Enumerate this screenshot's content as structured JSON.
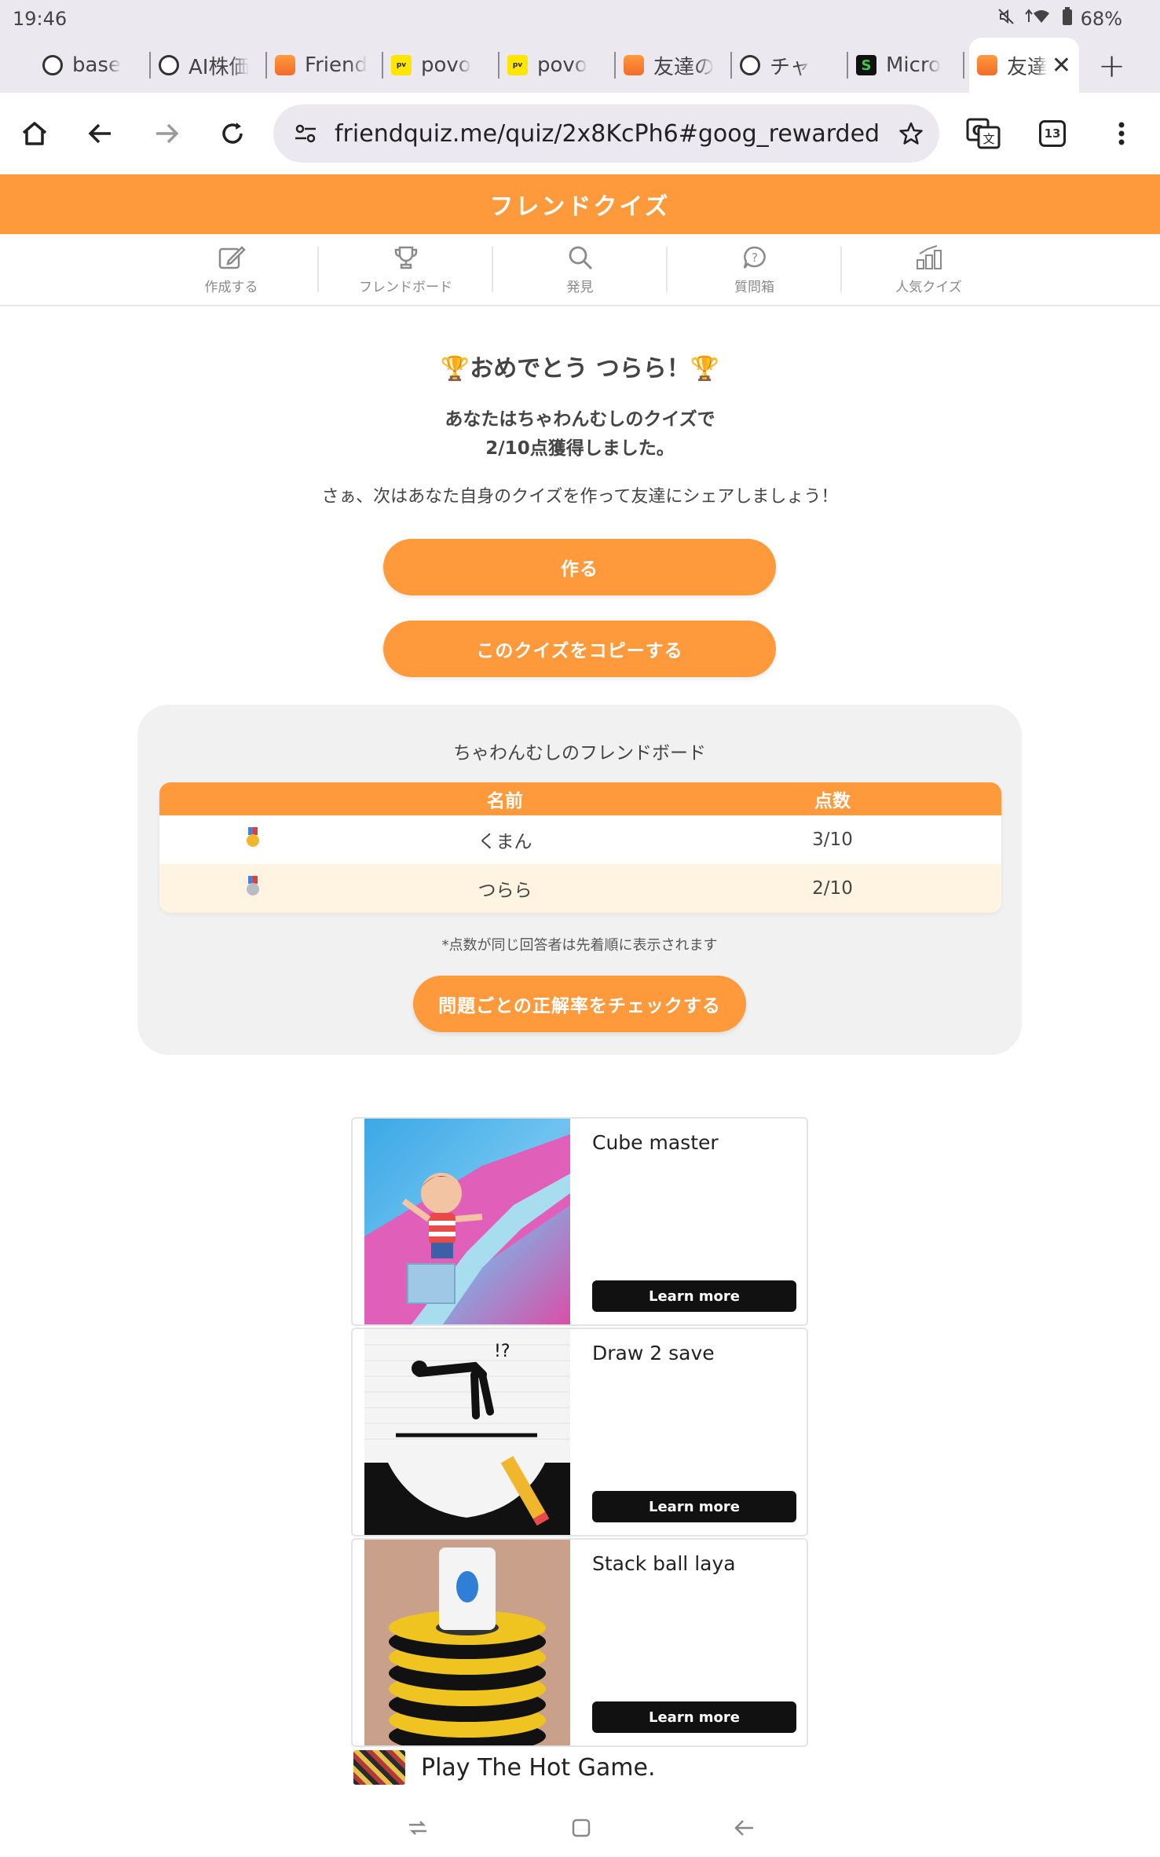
{
  "status_bar": {
    "time": "19:46",
    "battery": "68%"
  },
  "tabs": [
    {
      "label": "base",
      "favicon": "globe-icon"
    },
    {
      "label": "AI株価",
      "favicon": "globe-icon"
    },
    {
      "label": "Friend",
      "favicon": "friendquiz-favicon"
    },
    {
      "label": "povo",
      "favicon": "povo-favicon"
    },
    {
      "label": "povo",
      "favicon": "povo-favicon"
    },
    {
      "label": "友達の",
      "favicon": "friendquiz-favicon"
    },
    {
      "label": "チャ",
      "favicon": "globe-icon"
    },
    {
      "label": "Micro",
      "favicon": "s-favicon"
    }
  ],
  "active_tab": {
    "label": "友達",
    "favicon": "friendquiz-favicon"
  },
  "toolbar": {
    "url": "friendquiz.me/quiz/2x8KcPh6#goog_rewarded",
    "tab_count": "13"
  },
  "site": {
    "title": "フレンドクイズ",
    "nav": [
      {
        "label": "作成する",
        "icon": "edit-icon"
      },
      {
        "label": "フレンドボード",
        "icon": "trophy-icon"
      },
      {
        "label": "発見",
        "icon": "search-icon"
      },
      {
        "label": "質問箱",
        "icon": "question-bubble-icon"
      },
      {
        "label": "人気クイズ",
        "icon": "ranking-icon"
      }
    ]
  },
  "main": {
    "congrats": "🏆おめでとう つらら！🏆",
    "result_line1": "あなたはちゃわんむしのクイズで",
    "result_line2": "2/10点獲得しました。",
    "invite": "さぁ、次はあなた自身のクイズを作って友達にシェアしましょう！",
    "create_button": "作る",
    "copy_button": "このクイズをコピーする"
  },
  "board": {
    "title": "ちゃわんむしのフレンドボード",
    "headers": {
      "name": "名前",
      "score": "点数"
    },
    "rows": [
      {
        "medal": "gold",
        "name": "くまん",
        "score": "3/10"
      },
      {
        "medal": "silver",
        "name": "つらら",
        "score": "2/10"
      }
    ],
    "note": "*点数が同じ回答者は先着順に表示されます",
    "check_button": "問題ごとの正解率をチェックする"
  },
  "ads": [
    {
      "title": "Cube master",
      "button": "Learn more"
    },
    {
      "title": "Draw 2 save",
      "button": "Learn more"
    },
    {
      "title": "Stack ball laya",
      "button": "Learn more"
    }
  ],
  "ad_footer": "Play The Hot Game.",
  "colors": {
    "accent": "#ff9a3c",
    "chrome_bg": "#ece8ef",
    "row_alt": "#fff3e2"
  }
}
